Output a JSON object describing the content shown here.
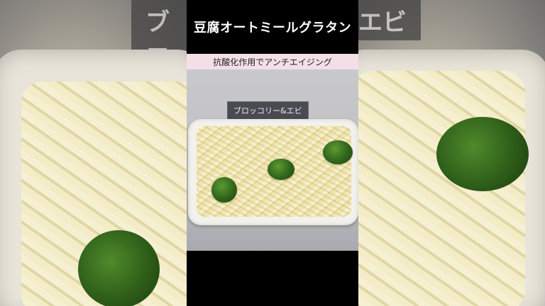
{
  "video": {
    "title": "豆腐オートミールグラタン",
    "subtitle": "抗酸化作用でアンチエイジング",
    "scene_tag": "ブロッコリー&エビ"
  },
  "backdrop": {
    "caption_left": "ブロ",
    "caption_right": "エビ"
  },
  "colors": {
    "subtitle_bg": "#f4dfe6",
    "tag_bg": "#4a4a52",
    "frame_bg": "#000000"
  }
}
